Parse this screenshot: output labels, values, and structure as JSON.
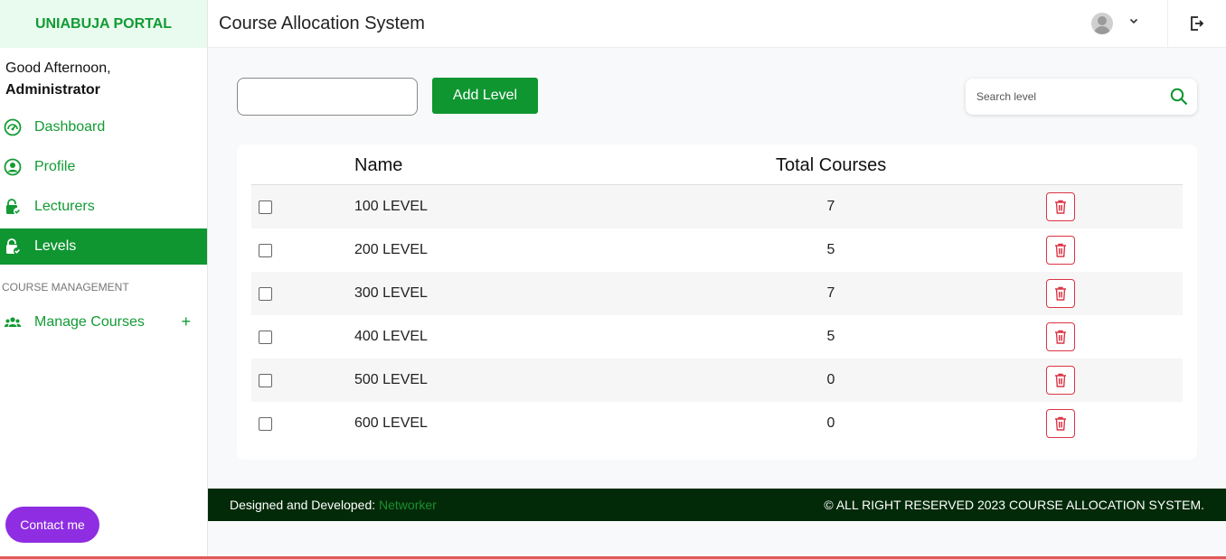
{
  "sidebar": {
    "brand": "UNIABUJA PORTAL",
    "greeting": "Good Afternoon,",
    "user": "Administrator",
    "items": [
      {
        "label": "Dashboard",
        "icon": "speedometer-icon"
      },
      {
        "label": "Profile",
        "icon": "user-circle-icon"
      },
      {
        "label": "Lecturers",
        "icon": "lock-check-icon"
      },
      {
        "label": "Levels",
        "icon": "lock-check-icon",
        "active": true
      }
    ],
    "section_label": "COURSE MANAGEMENT",
    "manage_courses": {
      "label": "Manage Courses",
      "icon": "users-icon",
      "toggle": "+"
    },
    "contact_button": "Contact me"
  },
  "header": {
    "title": "Course Allocation System",
    "avatar_icon": "avatar-icon",
    "dropdown_icon": "chevron-down-icon",
    "logout_icon": "logout-icon"
  },
  "controls": {
    "level_input_value": "",
    "add_button": "Add Level",
    "search_placeholder": "Search level"
  },
  "table": {
    "columns": [
      "Name",
      "Total Courses"
    ],
    "rows": [
      {
        "name": "100 LEVEL",
        "total": "7"
      },
      {
        "name": "200 LEVEL",
        "total": "5"
      },
      {
        "name": "300 LEVEL",
        "total": "7"
      },
      {
        "name": "400 LEVEL",
        "total": "5"
      },
      {
        "name": "500 LEVEL",
        "total": "0"
      },
      {
        "name": "600 LEVEL",
        "total": "0"
      }
    ]
  },
  "footer": {
    "designed_label": "Designed and Developed:",
    "developer": "Networker",
    "rights": "© ALL RIGHT RESERVED 2023 COURSE ALLOCATION SYSTEM."
  },
  "colors": {
    "brand_green": "#0f9631",
    "brand_bg": "#e9fbee",
    "footer_bg": "#022a08",
    "delete_red": "#dc3545",
    "contact_purple": "#8e2de2"
  }
}
